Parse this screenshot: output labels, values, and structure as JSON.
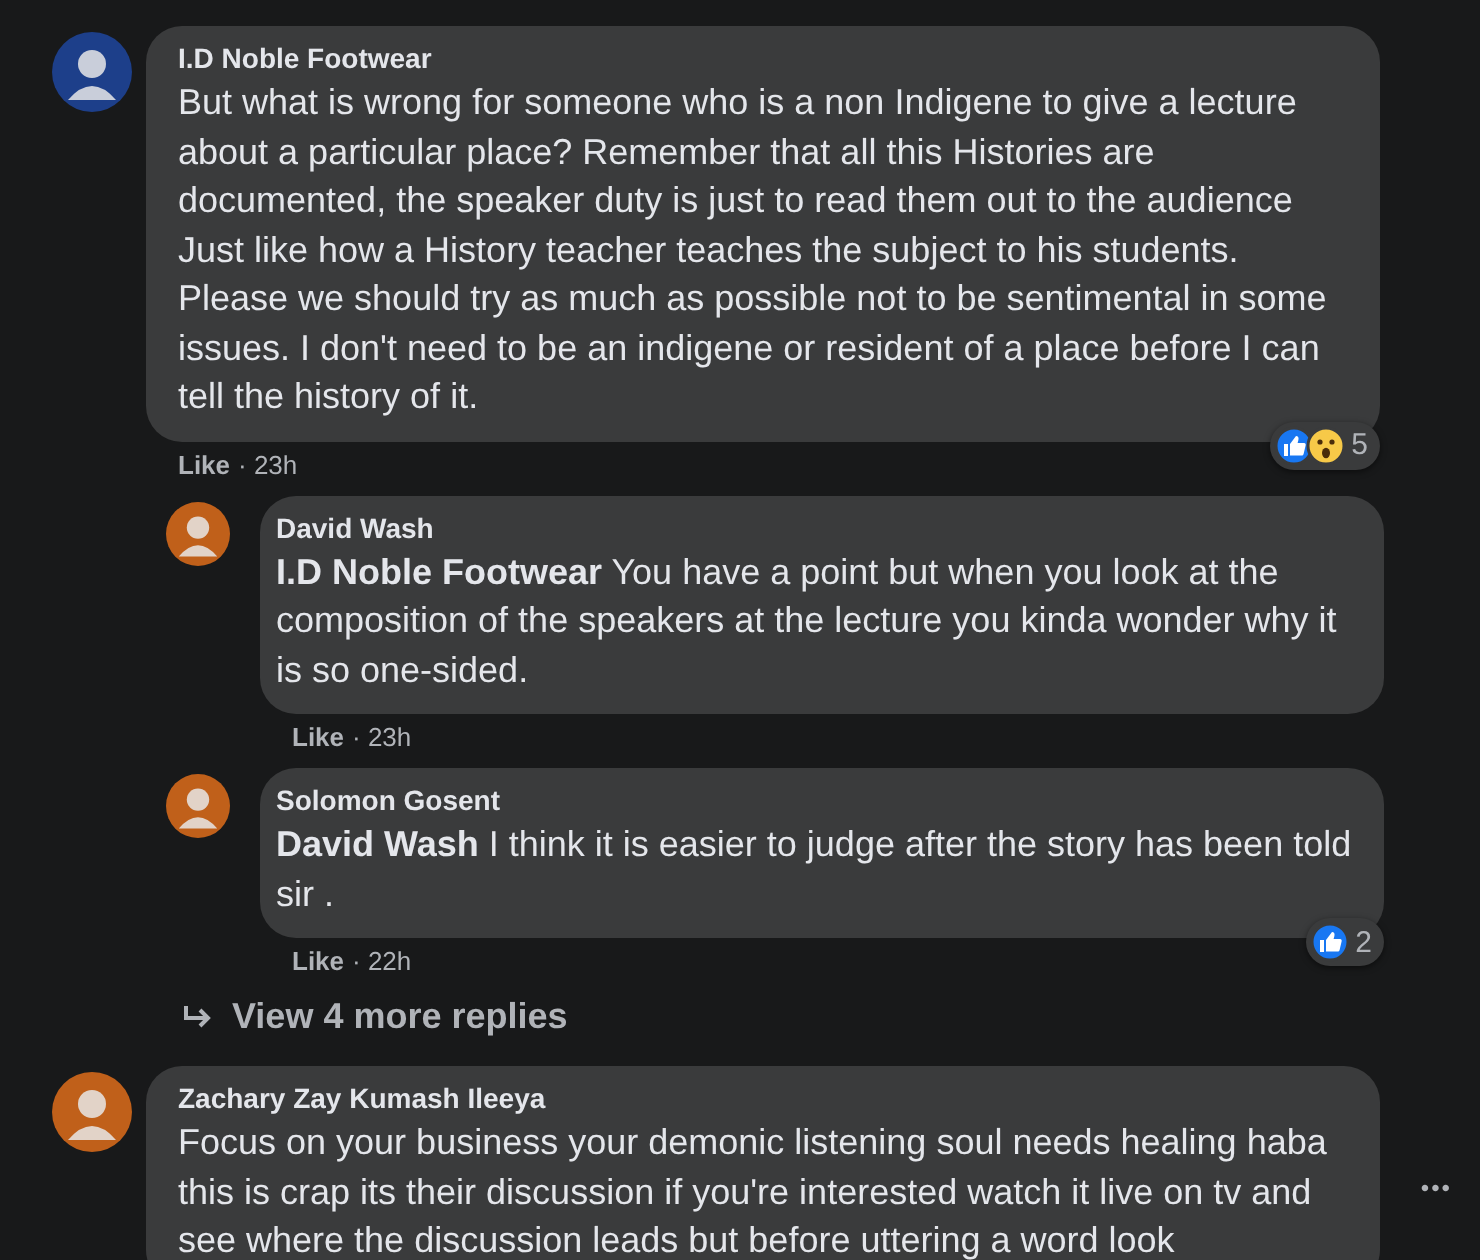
{
  "comments": [
    {
      "author": "I.D Noble Footwear",
      "text": "But what is wrong for someone who is a non Indigene to give a lecture about a particular place? Remember that all this Histories are documented, the speaker duty is just to read them out to the audience Just like how a History teacher teaches the subject to his students. Please we should try as much as possible not to be sentimental in some issues. I don't need to be an indigene or resident of a place before I can tell the history of it.",
      "like_label": "Like",
      "time": "· 23h",
      "reactions": {
        "icons": [
          {
            "kind": "like"
          },
          {
            "kind": "wow"
          }
        ],
        "count": "5"
      },
      "children": [
        {
          "author": "David Wash",
          "text": "**I.D Noble Footwear** You have a point but when you look at the composition of the speakers at the lecture you kinda wonder why it is so one-sided.",
          "like_label": "Like",
          "time": "· 23h"
        },
        {
          "author": "Solomon Gosent",
          "text": "**David Wash** I think it is easier to judge after the story has been told sir .",
          "like_label": "Like",
          "time": "· 22h",
          "reactions": {
            "icons": [
              {
                "kind": "like"
              }
            ],
            "count": "2"
          }
        }
      ],
      "more_replies": "View 4 more replies"
    },
    {
      "author": "Zachary Zay Kumash Ileeya",
      "text": "Focus on your business your demonic listening soul needs healing haba this is crap its their discussion if you're interested watch it live on tv and see where the discussion leads but before uttering a word look",
      "menu": "•••"
    }
  ]
}
